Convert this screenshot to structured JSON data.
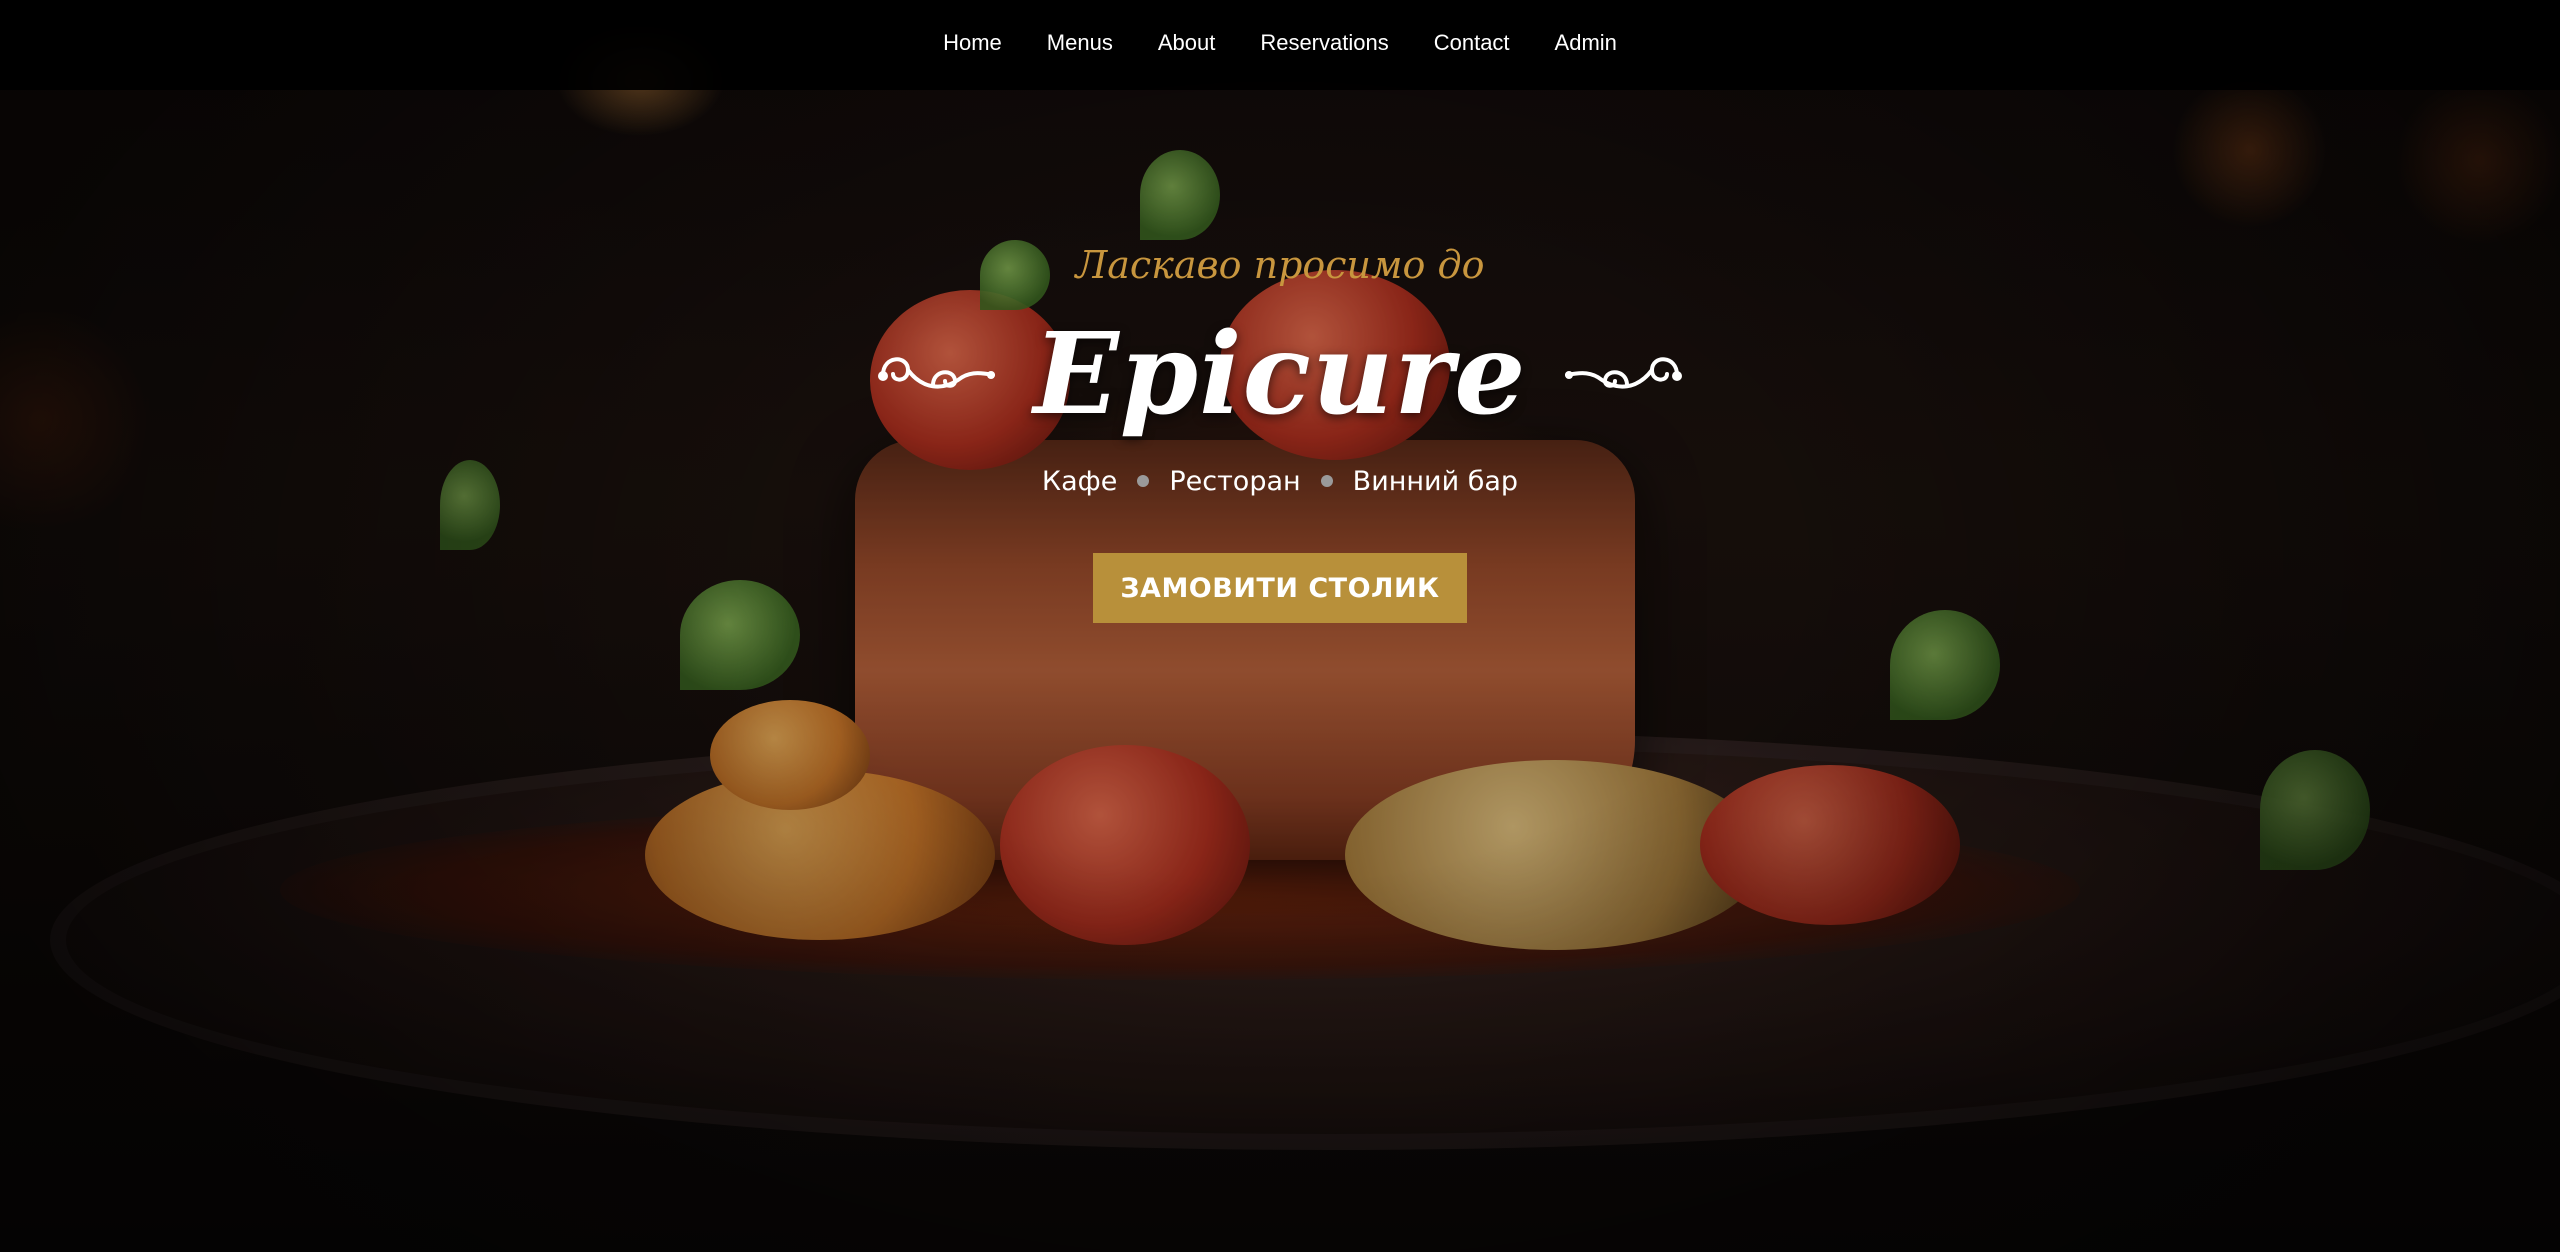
{
  "nav": {
    "items": [
      {
        "label": "Home"
      },
      {
        "label": "Menus"
      },
      {
        "label": "About"
      },
      {
        "label": "Reservations"
      },
      {
        "label": "Contact"
      },
      {
        "label": "Admin"
      }
    ]
  },
  "hero": {
    "welcome": "Ласкаво просимо до",
    "brand": "Epicure",
    "tagline": [
      "Кафе",
      "Ресторан",
      "Винний бар"
    ],
    "cta_label": "ЗАМОВИТИ СТОЛИК"
  },
  "colors": {
    "accent": "#b8903a",
    "welcome_text": "#c8963e",
    "navbar_bg": "#000000"
  },
  "icons": {
    "ornament_left": "swirl-ornament-icon",
    "ornament_right": "swirl-ornament-icon",
    "separator": "dot-icon"
  }
}
